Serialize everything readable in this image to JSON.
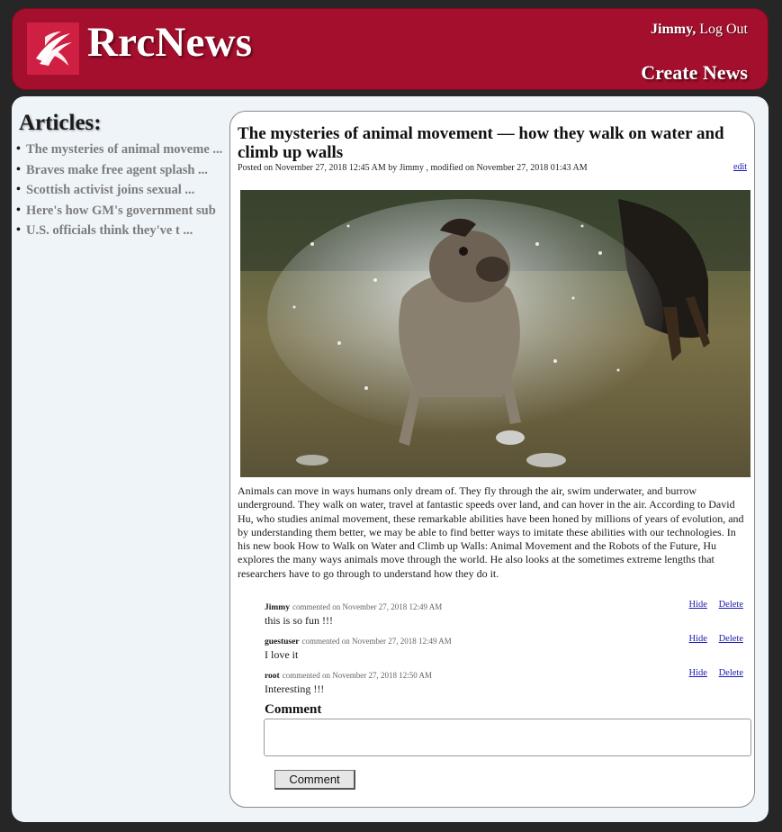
{
  "header": {
    "site_title": "RrcNews",
    "username": "Jimmy,",
    "logout_label": "Log Out",
    "create_news_label": "Create News",
    "brand_color": "#a30f2d",
    "logo_icon": "swirl-logo-icon"
  },
  "sidebar": {
    "title": "Articles:",
    "items": [
      {
        "label": "The mysteries of animal moveme ..."
      },
      {
        "label": "Braves make free agent splash ..."
      },
      {
        "label": "Scottish activist joins sexual ..."
      },
      {
        "label": "Here's how GM's government sub"
      },
      {
        "label": "U.S. officials think they've t ..."
      }
    ]
  },
  "article": {
    "title": "The mysteries of animal movement — how they walk on water and climb up walls",
    "meta": "Posted on November 27, 2018 12:45 AM by Jimmy , modified on November 27, 2018 01:43 AM",
    "edit_label": "edit",
    "image_subject": "dog shaking off water",
    "body": "Animals can move in ways humans only dream of. They fly through the air, swim underwater, and burrow underground. They walk on water, travel at fantastic speeds over land, and can hover in the air. According to David Hu, who studies animal movement, these remarkable abilities have been honed by millions of years of evolution, and by understanding them better, we may be able to find better ways to imitate these abilities with our technologies. In his new book How to Walk on Water and Climb up Walls: Animal Movement and the Robots of the Future, Hu explores the many ways animals move through the world. He also looks at the sometimes extreme lengths that researchers have to go through to understand how they do it."
  },
  "comments": [
    {
      "author": "Jimmy",
      "meta": "commented on November 27, 2018 12:49 AM",
      "text": "this is so fun !!!",
      "hide_label": "Hide",
      "delete_label": "Delete"
    },
    {
      "author": "guestuser",
      "meta": "commented on November 27, 2018 12:49 AM",
      "text": "I love it",
      "hide_label": "Hide",
      "delete_label": "Delete"
    },
    {
      "author": "root",
      "meta": "commented on November 27, 2018 12:50 AM",
      "text": "Interesting !!!",
      "hide_label": "Hide",
      "delete_label": "Delete"
    }
  ],
  "comment_form": {
    "label": "Comment",
    "input_value": "",
    "button_label": "Comment"
  }
}
